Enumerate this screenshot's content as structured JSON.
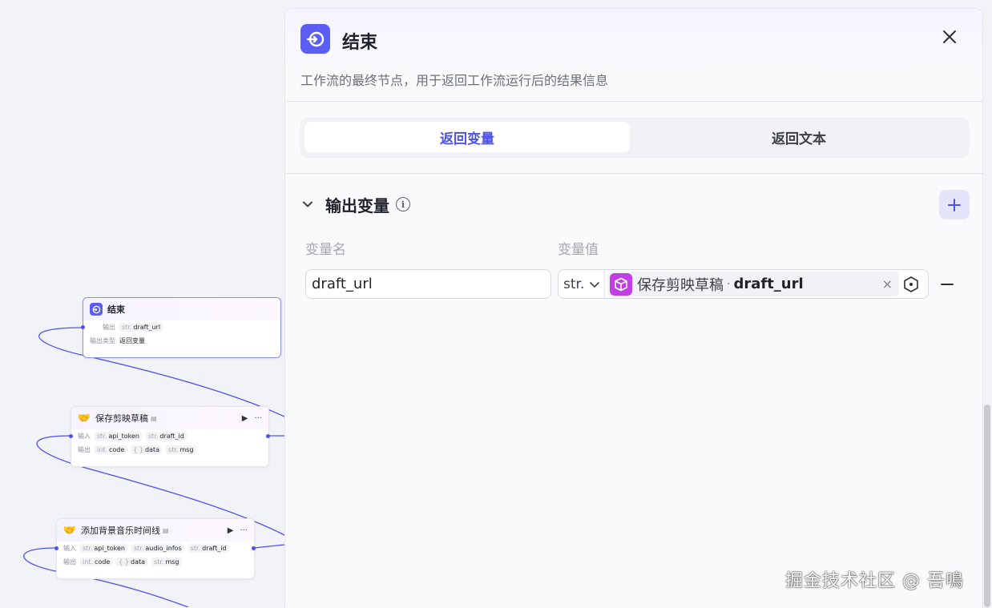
{
  "canvas": {
    "end_node": {
      "title": "结束",
      "rows": [
        {
          "label": "输出",
          "chips": [
            {
              "type": "str.",
              "name": "draft_url"
            }
          ]
        },
        {
          "label": "输出类型",
          "value": "返回变量"
        }
      ]
    },
    "save_node": {
      "title": "保存剪映草稿",
      "rows": [
        {
          "label": "输入",
          "chips": [
            {
              "type": "str.",
              "name": "api_token"
            },
            {
              "type": "str.",
              "name": "draft_id"
            }
          ]
        },
        {
          "label": "输出",
          "chips": [
            {
              "type": "int.",
              "name": "code"
            },
            {
              "type": "{ }",
              "name": "data"
            },
            {
              "type": "str.",
              "name": "msg"
            }
          ]
        }
      ]
    },
    "music_node": {
      "title": "添加背景音乐时间线",
      "rows": [
        {
          "label": "输入",
          "chips": [
            {
              "type": "str.",
              "name": "api_token"
            },
            {
              "type": "str.",
              "name": "audio_infos"
            },
            {
              "type": "str.",
              "name": "draft_id"
            }
          ]
        },
        {
          "label": "输出",
          "chips": [
            {
              "type": "int.",
              "name": "code"
            },
            {
              "type": "{ }",
              "name": "data"
            },
            {
              "type": "str.",
              "name": "msg"
            }
          ]
        }
      ]
    }
  },
  "panel": {
    "title": "结束",
    "description": "工作流的最终节点，用于返回工作流运行后的结果信息",
    "tabs": [
      {
        "label": "返回变量",
        "active": true
      },
      {
        "label": "返回文本",
        "active": false
      }
    ],
    "section_title": "输出变量",
    "col_name_label": "变量名",
    "col_value_label": "变量值",
    "output": {
      "name": "draft_url",
      "type": "str.",
      "ref_node": "保存剪映草稿",
      "ref_sep": "·",
      "ref_var": "draft_url"
    }
  },
  "watermark": "掘金技术社区 @ 吾鳴",
  "colors": {
    "accent": "#4d53e8",
    "end_icon": "#5b5ef5",
    "plugin_icon": "#c13ee6"
  }
}
